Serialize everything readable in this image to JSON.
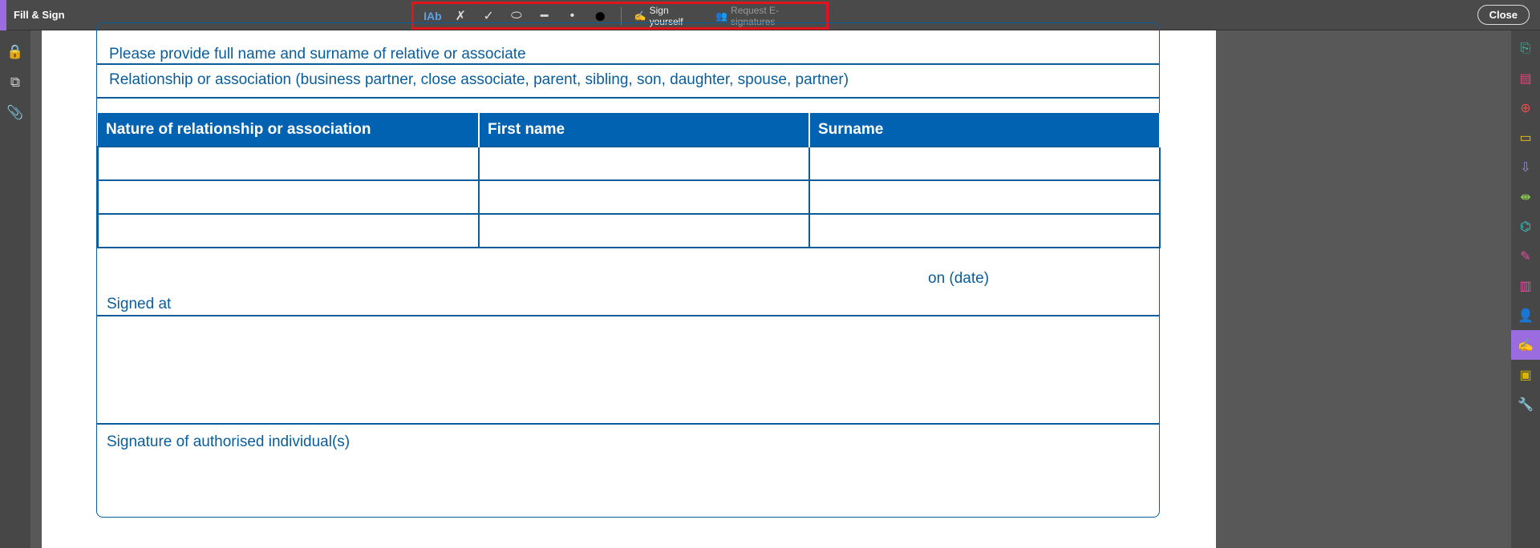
{
  "app": {
    "title": "Fill & Sign",
    "close_label": "Close"
  },
  "toolbar": {
    "tools": [
      {
        "name": "add-text",
        "glyph": "IAb"
      },
      {
        "name": "cross",
        "glyph": "✗"
      },
      {
        "name": "check",
        "glyph": "✓"
      },
      {
        "name": "ellipse",
        "glyph": "⬭"
      },
      {
        "name": "line",
        "glyph": "━"
      },
      {
        "name": "dot",
        "glyph": "•"
      },
      {
        "name": "color",
        "glyph": "●"
      }
    ],
    "sign_yourself": "Sign yourself",
    "request_esign": "Request E-signatures"
  },
  "form": {
    "line1": "Please provide full name and surname of relative or associate",
    "line2": "Relationship or association (business partner, close associate, parent, sibling, son, daughter, spouse, partner)",
    "columns": [
      "Nature of relationship or association",
      "First name",
      "Surname"
    ],
    "signed_at": "Signed at",
    "on_date": "on (date)",
    "signature": "Signature of authorised individual(s)"
  },
  "colors": {
    "accent": "#9b6ce0",
    "form_blue": "#0a5d9a",
    "header_blue": "#0062b0"
  }
}
